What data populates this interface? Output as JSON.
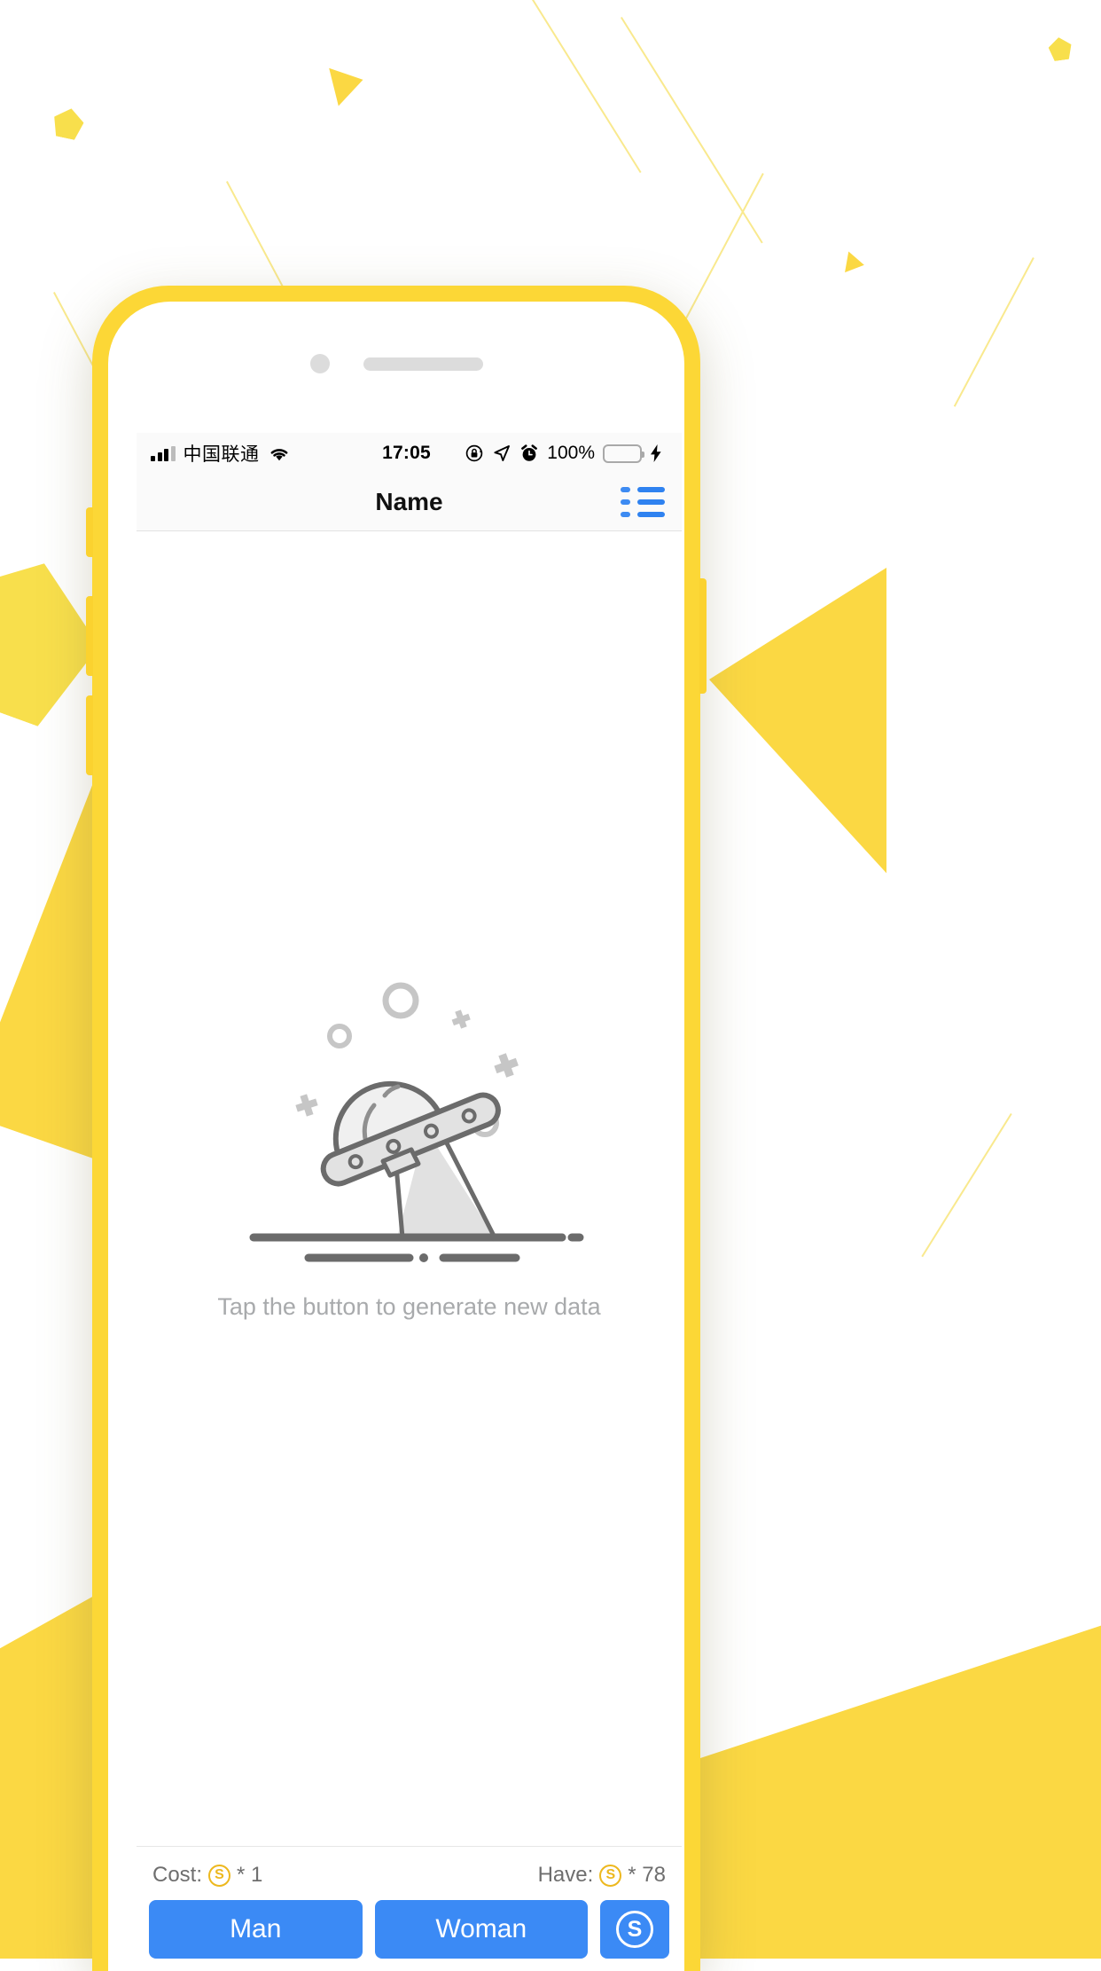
{
  "theme": {
    "frame_yellow": "#FCD736",
    "accent_blue": "#3B8AF5",
    "coin_gold": "#EDB81E",
    "muted_text": "#A8AAAC",
    "battery_green": "#4CD964"
  },
  "status_bar": {
    "carrier": "中国联通",
    "signal_icon": "signal-bars-icon",
    "wifi_icon": "wifi-icon",
    "time": "17:05",
    "rotation_lock_icon": "rotation-lock-icon",
    "location_icon": "location-arrow-icon",
    "alarm_icon": "alarm-clock-icon",
    "battery_percent": "100%",
    "battery_icon": "battery-icon",
    "charging_icon": "lightning-bolt-icon"
  },
  "nav_bar": {
    "title": "Name",
    "action_icon": "list-icon"
  },
  "content": {
    "illustration": "ufo-beam-illustration",
    "empty_text": "Tap the button to generate new data"
  },
  "bottom_bar": {
    "cost_label": "Cost:",
    "cost_coin_icon": "coin-icon",
    "cost_symbol": "S",
    "cost_multiplier": "* 1",
    "have_label": "Have:",
    "have_coin_icon": "coin-icon",
    "have_symbol": "S",
    "have_multiplier": "* 78",
    "buttons": {
      "man": "Man",
      "woman": "Woman",
      "coin_icon": "coin-button-icon",
      "coin_symbol": "S"
    }
  },
  "device": {
    "camera_icon": "front-camera-icon",
    "speaker_icon": "earpiece-speaker-icon"
  }
}
